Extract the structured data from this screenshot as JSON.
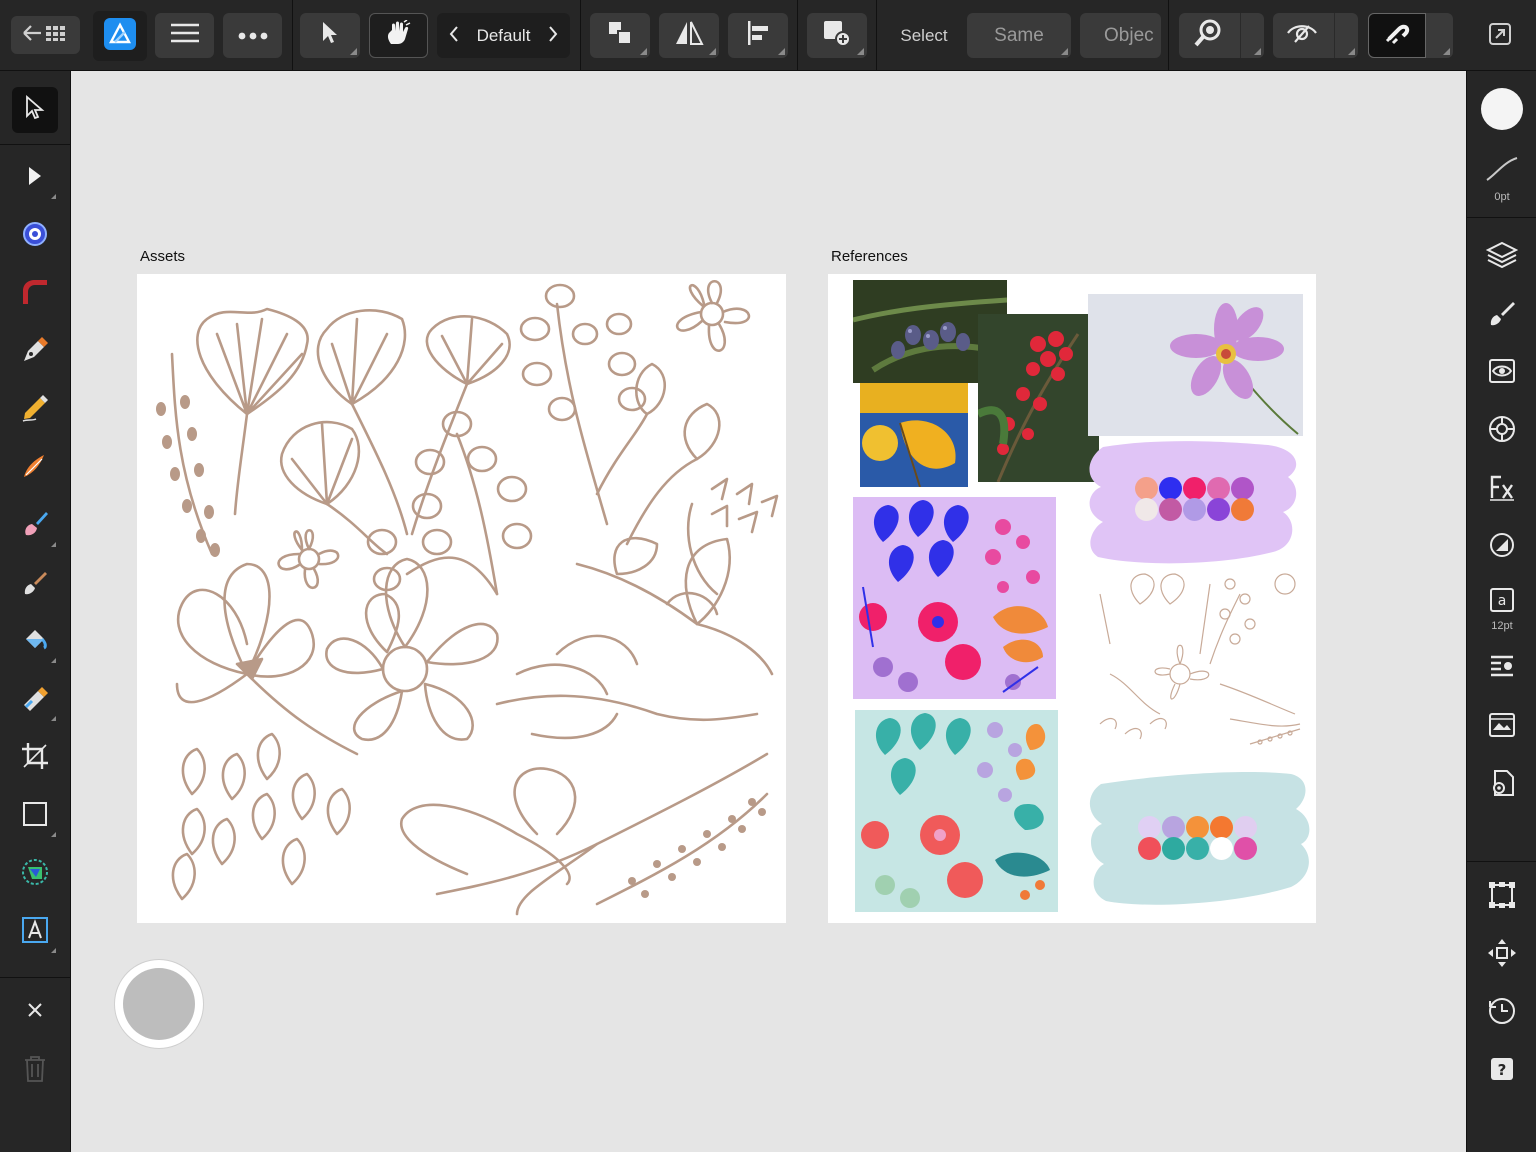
{
  "toolbar": {
    "style_label": "Default",
    "select_label": "Select",
    "same_label": "Same",
    "object_label": "Objec"
  },
  "right_panel": {
    "stroke_width": "0pt",
    "text_size": "12pt"
  },
  "canvas": {
    "artboards": [
      {
        "name": "Assets"
      },
      {
        "name": "References"
      }
    ]
  },
  "palettes": {
    "purple": [
      "#f4a08a",
      "#2e2ef0",
      "#f0206a",
      "#e06ab0",
      "#b055c8",
      "#f0e8e8",
      "#c25aa4",
      "#b09ae6",
      "#8a44d8",
      "#f07a38"
    ],
    "teal": [
      "#e0d0f4",
      "#b8a4e0",
      "#f4923a",
      "#f47830",
      "#e0cef0",
      "#f0505a",
      "#2eaaa0",
      "#38b0a8",
      "#ffffff",
      "#e050a8"
    ]
  },
  "colors": {
    "ui_background": "#262626",
    "canvas_background": "#e5e5e5",
    "accent": "#1e8ef0",
    "line_art": "#b89a88"
  },
  "icons": [
    "back-grid-icon",
    "affinity-designer-logo-icon",
    "hamburger-menu-icon",
    "more-icon",
    "pointer-icon",
    "gesture-hand-icon",
    "arrange-icon",
    "flip-icon",
    "align-icon",
    "insert-icon",
    "zoom-icon",
    "view-mode-icon",
    "snapping-magnet-icon",
    "export-persona-icon"
  ]
}
